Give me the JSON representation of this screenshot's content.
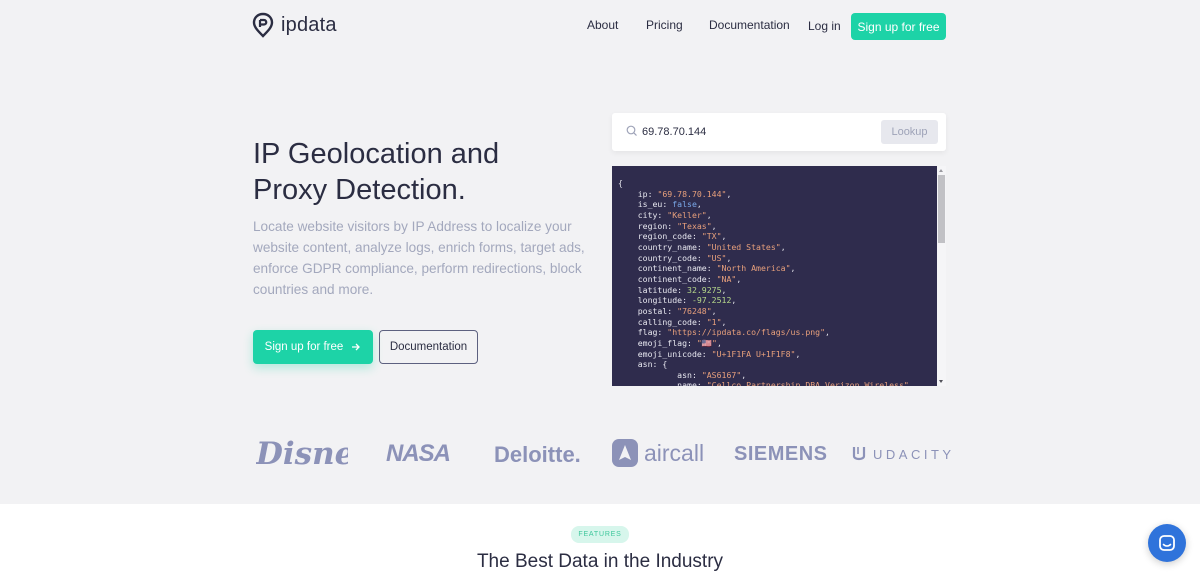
{
  "nav": {
    "brand": "ipdata",
    "links": [
      "About",
      "Pricing",
      "Documentation",
      "Log in"
    ],
    "signup": "Sign up for free"
  },
  "hero": {
    "title_line1": "IP Geolocation and",
    "title_line2": "Proxy Detection.",
    "description": "Locate website visitors by IP Address to localize your website content, analyze logs, enrich forms, target ads, enforce GDPR compliance, perform redirections, block countries and more.",
    "signup_button": "Sign up for free",
    "docs_button": "Documentation"
  },
  "lookup": {
    "value": "69.78.70.144",
    "button": "Lookup"
  },
  "response": [
    {
      "key": "ip",
      "value": "\"69.78.70.144\"",
      "type": "s"
    },
    {
      "key": "is_eu",
      "value": "false",
      "type": "b"
    },
    {
      "key": "city",
      "value": "\"Keller\"",
      "type": "s"
    },
    {
      "key": "region",
      "value": "\"Texas\"",
      "type": "s"
    },
    {
      "key": "region_code",
      "value": "\"TX\"",
      "type": "s"
    },
    {
      "key": "country_name",
      "value": "\"United States\"",
      "type": "s"
    },
    {
      "key": "country_code",
      "value": "\"US\"",
      "type": "s"
    },
    {
      "key": "continent_name",
      "value": "\"North America\"",
      "type": "s"
    },
    {
      "key": "continent_code",
      "value": "\"NA\"",
      "type": "s"
    },
    {
      "key": "latitude",
      "value": "32.9275",
      "type": "n"
    },
    {
      "key": "longitude",
      "value": "-97.2512",
      "type": "n"
    },
    {
      "key": "postal",
      "value": "\"76248\"",
      "type": "s"
    },
    {
      "key": "calling_code",
      "value": "\"1\"",
      "type": "s"
    },
    {
      "key": "flag",
      "value": "\"https://ipdata.co/flags/us.png\"",
      "type": "s"
    },
    {
      "key": "emoji_flag",
      "value": "\"🇺🇸\"",
      "type": "s"
    },
    {
      "key": "emoji_unicode",
      "value": "\"U+1F1FA U+1F1F8\"",
      "type": "s"
    },
    {
      "key": "asn",
      "value": "{",
      "type": "k",
      "nocomma": true
    },
    {
      "key": "asn",
      "value": "\"AS6167\"",
      "type": "s",
      "indent": 2
    },
    {
      "key": "name",
      "value": "\"Cellco Partnership DBA Verizon Wireless\"",
      "type": "s",
      "indent": 2
    }
  ],
  "brands": [
    "Disney",
    "NASA",
    "Deloitte.",
    "aircall",
    "SIEMENS",
    "UDACITY"
  ],
  "section": {
    "badge": "FEATURES",
    "title": "The Best Data in the Industry"
  },
  "colors": {
    "accent": "#1dd3a7",
    "code_bg": "#2f2c4d",
    "brand_logo": "#8c92b8"
  }
}
